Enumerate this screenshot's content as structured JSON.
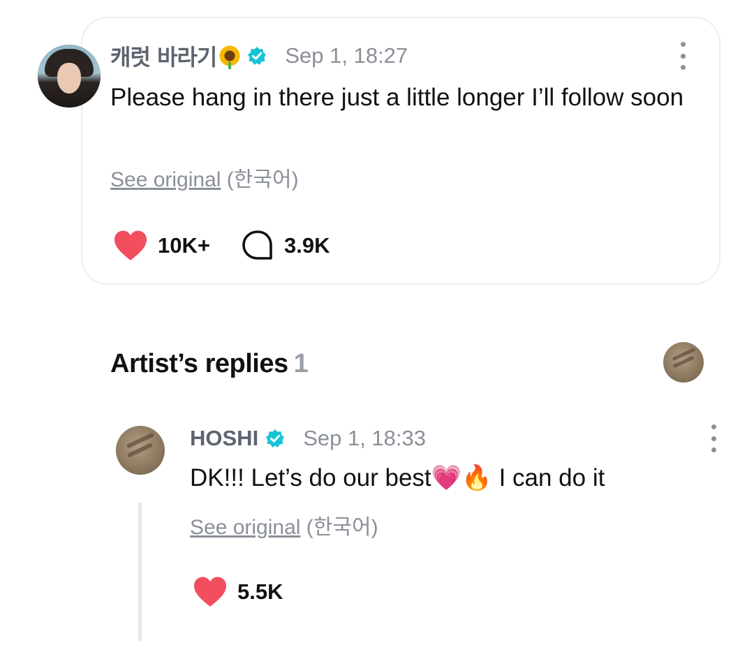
{
  "post": {
    "author": "캐럿 바라기",
    "author_emoji": "🌻",
    "timestamp": "Sep 1, 18:27",
    "text": "Please hang in there just a little longer I’ll follow soon",
    "see_original_link": "See original",
    "see_original_lang": "(한국어)",
    "likes": "10K+",
    "comments": "3.9K"
  },
  "replies": {
    "title": "Artist’s replies",
    "count": "1",
    "items": [
      {
        "author": "HOSHI",
        "timestamp": "Sep 1, 18:33",
        "text_before": "DK!!! Let’s do our best",
        "emoji_heart": "💗",
        "emoji_fire": "🔥",
        "text_after": " I can do it",
        "see_original_link": "See original",
        "see_original_lang": "(한국어)",
        "likes": "5.5K"
      }
    ]
  },
  "colors": {
    "verified_badge": "#17c3d6",
    "heart": "#f24e5e",
    "muted_text": "#8a8f98"
  }
}
